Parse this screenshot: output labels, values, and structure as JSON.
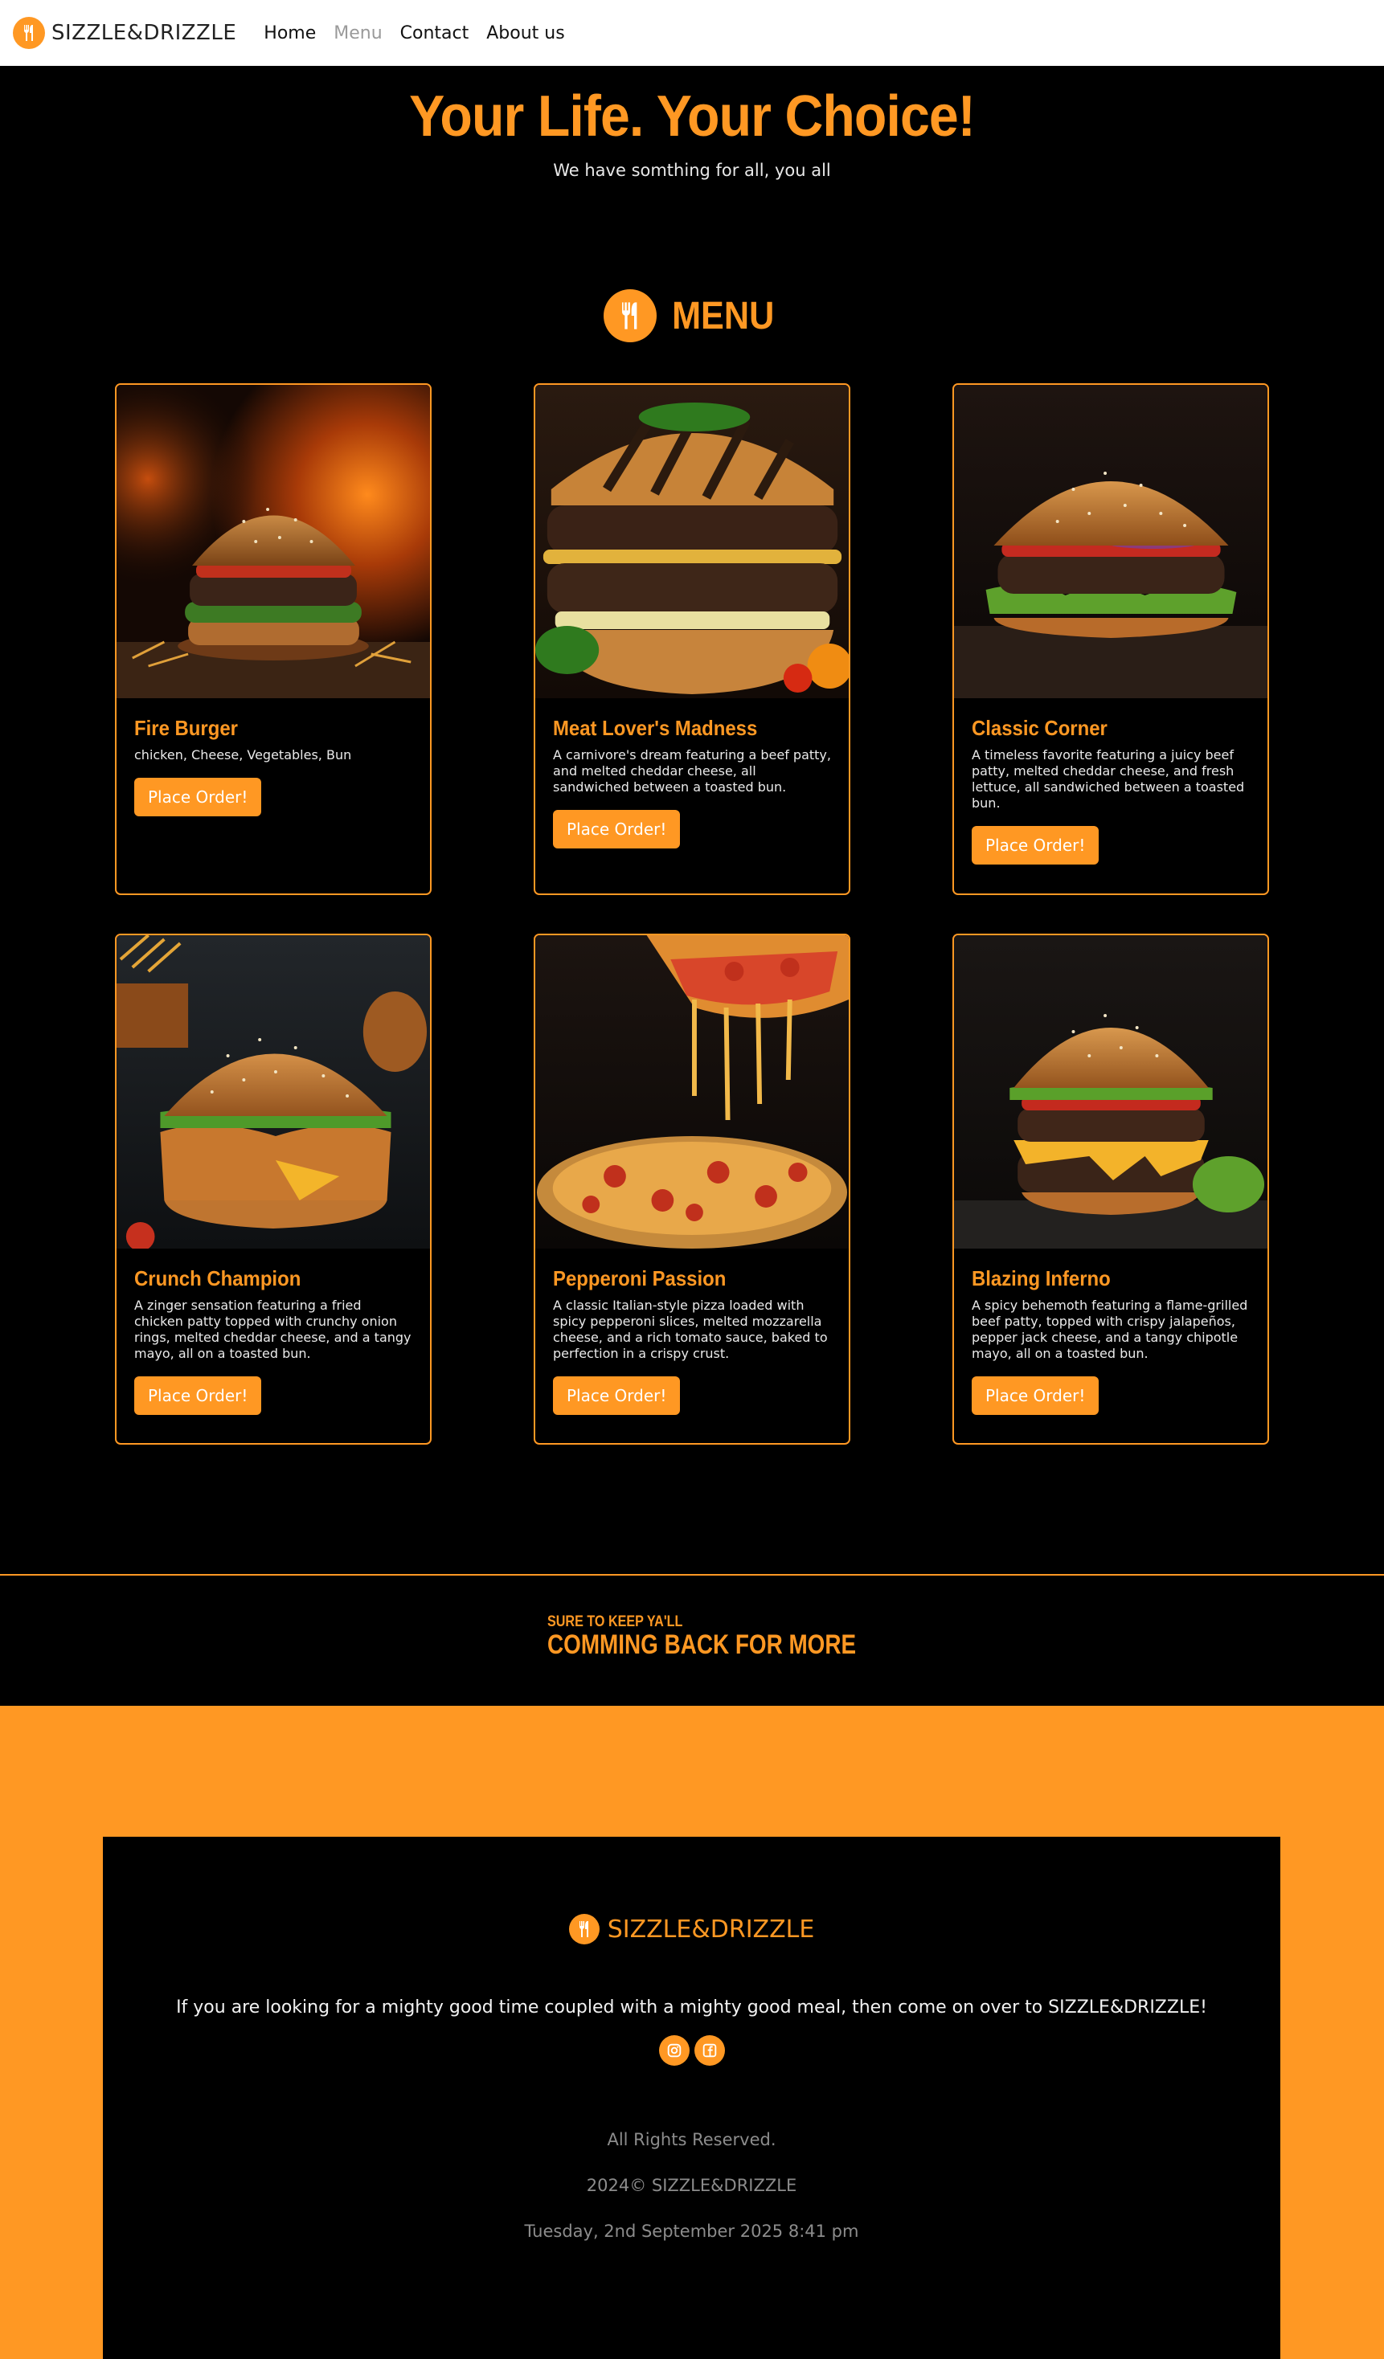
{
  "nav": {
    "brand": "SIZZLE&DRIZZLE",
    "logo_icon": "utensils-icon",
    "links": [
      "Home",
      "Menu",
      "Contact",
      "About us"
    ],
    "active_link": "Menu"
  },
  "hero": {
    "title": "Your Life. Your Choice!",
    "subtitle": "We have somthing for all, you all"
  },
  "menu": {
    "heading": "MENU",
    "heading_icon": "utensils-icon",
    "items": [
      {
        "title": "Fire Burger",
        "description": "chicken, Cheese, Vegetables, Bun",
        "button": "Place Order!",
        "image": "burger-flames-photo"
      },
      {
        "title": "Meat Lover's Madness",
        "description": "A carnivore's dream featuring a beef patty, and melted cheddar cheese, all sandwiched between a toasted bun.",
        "button": "Place Order!",
        "image": "double-patty-burger-photo"
      },
      {
        "title": "Classic Corner",
        "description": "A timeless favorite featuring a juicy beef patty, melted cheddar cheese, and fresh lettuce, all sandwiched between a toasted bun.",
        "button": "Place Order!",
        "image": "classic-burger-photo"
      },
      {
        "title": "Crunch Champion",
        "description": "A zinger sensation featuring a fried chicken patty topped with crunchy onion rings, melted cheddar cheese, and a tangy mayo, all on a toasted bun.",
        "button": "Place Order!",
        "image": "fried-chicken-burger-photo"
      },
      {
        "title": "Pepperoni Passion",
        "description": "A classic Italian-style pizza loaded with spicy pepperoni slices, melted mozzarella cheese, and a rich tomato sauce, baked to perfection in a crispy crust.",
        "button": "Place Order!",
        "image": "pepperoni-pizza-photo"
      },
      {
        "title": "Blazing Inferno",
        "description": "A spicy behemoth featuring a flame-grilled beef patty, topped with crispy jalapeños, pepper jack cheese, and a tangy chipotle mayo, all on a toasted bun.",
        "button": "Place Order!",
        "image": "spicy-burger-photo"
      }
    ]
  },
  "tagline": {
    "small": "SURE TO KEEP YA'LL",
    "big": "COMMING BACK FOR MORE"
  },
  "footer": {
    "brand": "SIZZLE&DRIZZLE",
    "text": "If you are looking for a mighty good time coupled with a mighty good meal, then come on over to SIZZLE&DRIZZLE!",
    "socials": [
      "instagram-icon",
      "facebook-icon"
    ],
    "rights": "All Rights Reserved.",
    "copyright": "2024© SIZZLE&DRIZZLE",
    "datetime": "Tuesday, 2nd September 2025 8:41 pm"
  },
  "colors": {
    "accent": "#ff9823",
    "background": "#000000",
    "nav_bg": "#ffffff"
  }
}
